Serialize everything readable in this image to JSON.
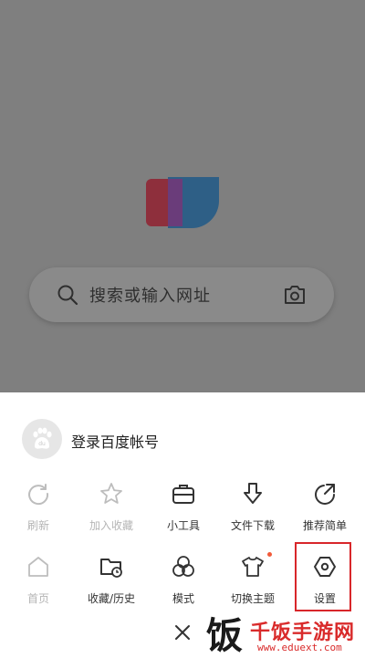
{
  "search": {
    "placeholder": "搜索或输入网址"
  },
  "account": {
    "login_label": "登录百度帐号"
  },
  "menu": {
    "row1": [
      {
        "label": "刷新",
        "icon": "refresh-icon",
        "enabled": false
      },
      {
        "label": "加入收藏",
        "icon": "star-icon",
        "enabled": false
      },
      {
        "label": "小工具",
        "icon": "toolbox-icon",
        "enabled": true
      },
      {
        "label": "文件下载",
        "icon": "download-icon",
        "enabled": true
      },
      {
        "label": "推荐简单",
        "icon": "share-icon",
        "enabled": true
      }
    ],
    "row2": [
      {
        "label": "首页",
        "icon": "home-icon",
        "enabled": false
      },
      {
        "label": "收藏/历史",
        "icon": "folder-history-icon",
        "enabled": true
      },
      {
        "label": "模式",
        "icon": "mode-icon",
        "enabled": true
      },
      {
        "label": "切换主题",
        "icon": "tshirt-icon",
        "enabled": true,
        "badge": true
      },
      {
        "label": "设置",
        "icon": "settings-hexagon-icon",
        "enabled": true
      }
    ]
  },
  "watermark": {
    "logo": "饭",
    "site_name": "千饭手游网",
    "url": "www.eduext.com"
  },
  "colors": {
    "highlight": "#d8262a",
    "badge": "#f25a3a",
    "overlay": "#7f7f7f"
  }
}
